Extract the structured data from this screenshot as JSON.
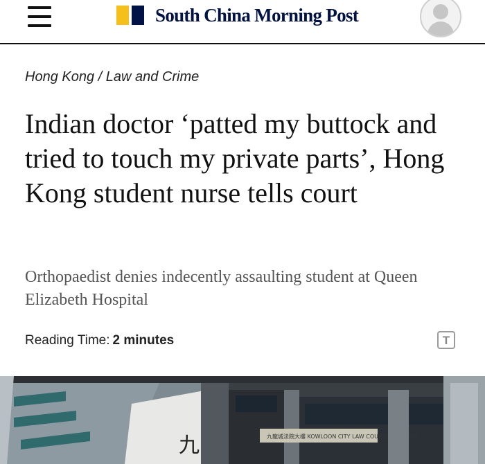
{
  "header": {
    "menu_icon": "hamburger-menu-icon",
    "brand_name": "South China Morning Post",
    "brand_colors": {
      "yellow": "#f6c01c",
      "navy": "#001246"
    },
    "avatar_icon": "user-avatar-icon"
  },
  "breadcrumb": {
    "section": "Hong Kong",
    "separator": "/",
    "subsection": "Law and Crime"
  },
  "article": {
    "headline": "Indian doctor ‘patted my buttock and tried to touch my private parts’, Hong Kong student nurse tells court",
    "subheadline": "Orthopaedist denies indecently assaulting student at Queen Elizabeth Hospital",
    "reading_time_label": "Reading Time:",
    "reading_time_value": "2 minutes",
    "text_size_icon": "text-size-icon",
    "text_size_glyph": "T",
    "hero_image_alt": "Kowloon City Law Courts Building",
    "hero_sign_chars": "九",
    "hero_sign_text": "九龍城法院大樓 KOWLOON CITY LAW COURTS BUILDING"
  }
}
